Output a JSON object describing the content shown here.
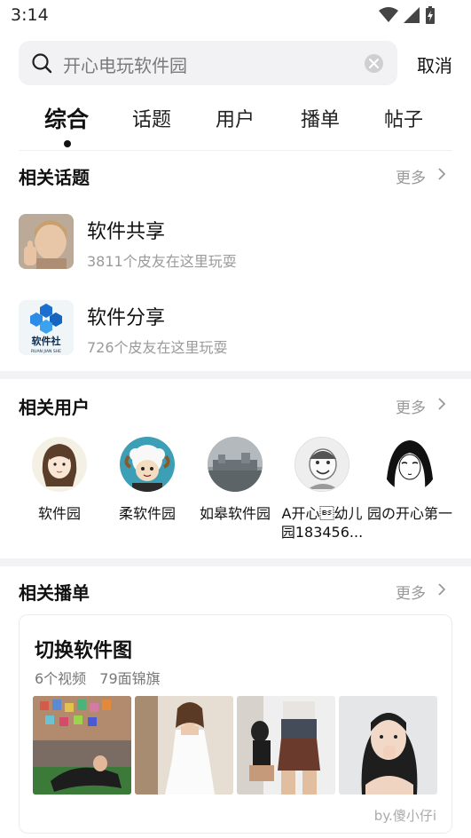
{
  "status": {
    "time": "3:14"
  },
  "search": {
    "query": "开心电玩软件园",
    "cancel_label": "取消"
  },
  "tabs": [
    {
      "label": "综合"
    },
    {
      "label": "话题"
    },
    {
      "label": "用户"
    },
    {
      "label": "播单"
    },
    {
      "label": "帖子"
    }
  ],
  "topics": {
    "title": "相关话题",
    "more": "更多",
    "items": [
      {
        "name": "软件共享",
        "sub": "3811个皮友在这里玩耍"
      },
      {
        "name": "软件分享",
        "sub": "726个皮友在这里玩耍",
        "logo_text": "软件社",
        "logo_sub": "RUAN JIAN SHE"
      }
    ]
  },
  "users": {
    "title": "相关用户",
    "more": "更多",
    "items": [
      {
        "name": "软件园"
      },
      {
        "name": "柔软件园"
      },
      {
        "name": "如皋软件园"
      },
      {
        "name": "A开心\b幼儿园183456..."
      },
      {
        "name": "园の开心第一"
      }
    ]
  },
  "playlists": {
    "title": "相关播单",
    "more": "更多",
    "card": {
      "title": "切换软件图",
      "video_count": "6个视频",
      "flag_count": "79面锦旗",
      "author": "by.傻小仔i"
    }
  },
  "colors": {
    "accent": "#111111",
    "muted": "#999999",
    "section_gap": "#f3f3f5"
  }
}
